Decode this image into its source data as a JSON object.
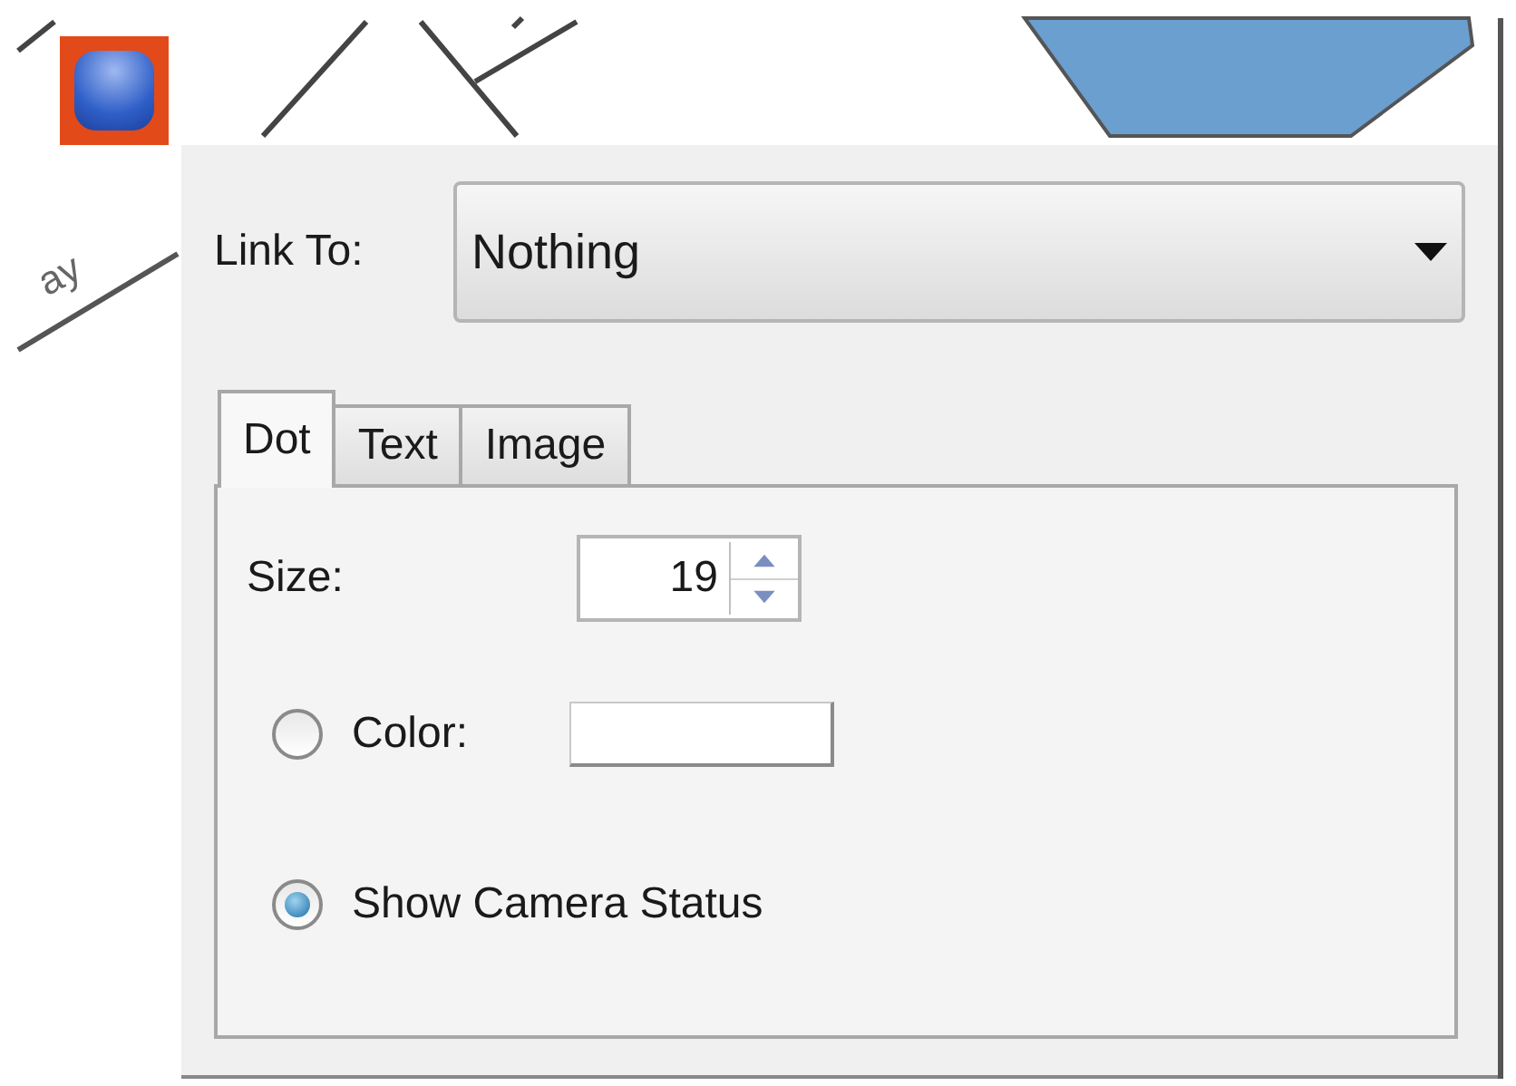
{
  "canvas": {
    "marker": {
      "selected": true
    },
    "labels": [
      "ay"
    ]
  },
  "panel": {
    "link_to": {
      "label": "Link To:",
      "value": "Nothing"
    },
    "tabs": [
      {
        "label": "Dot",
        "selected": true
      },
      {
        "label": "Text",
        "selected": false
      },
      {
        "label": "Image",
        "selected": false
      }
    ],
    "size": {
      "label": "Size:",
      "value": "19"
    },
    "options": [
      {
        "kind": "color",
        "label": "Color:",
        "selected": false
      },
      {
        "kind": "plain",
        "label": "Show Camera Status",
        "selected": true
      }
    ]
  }
}
